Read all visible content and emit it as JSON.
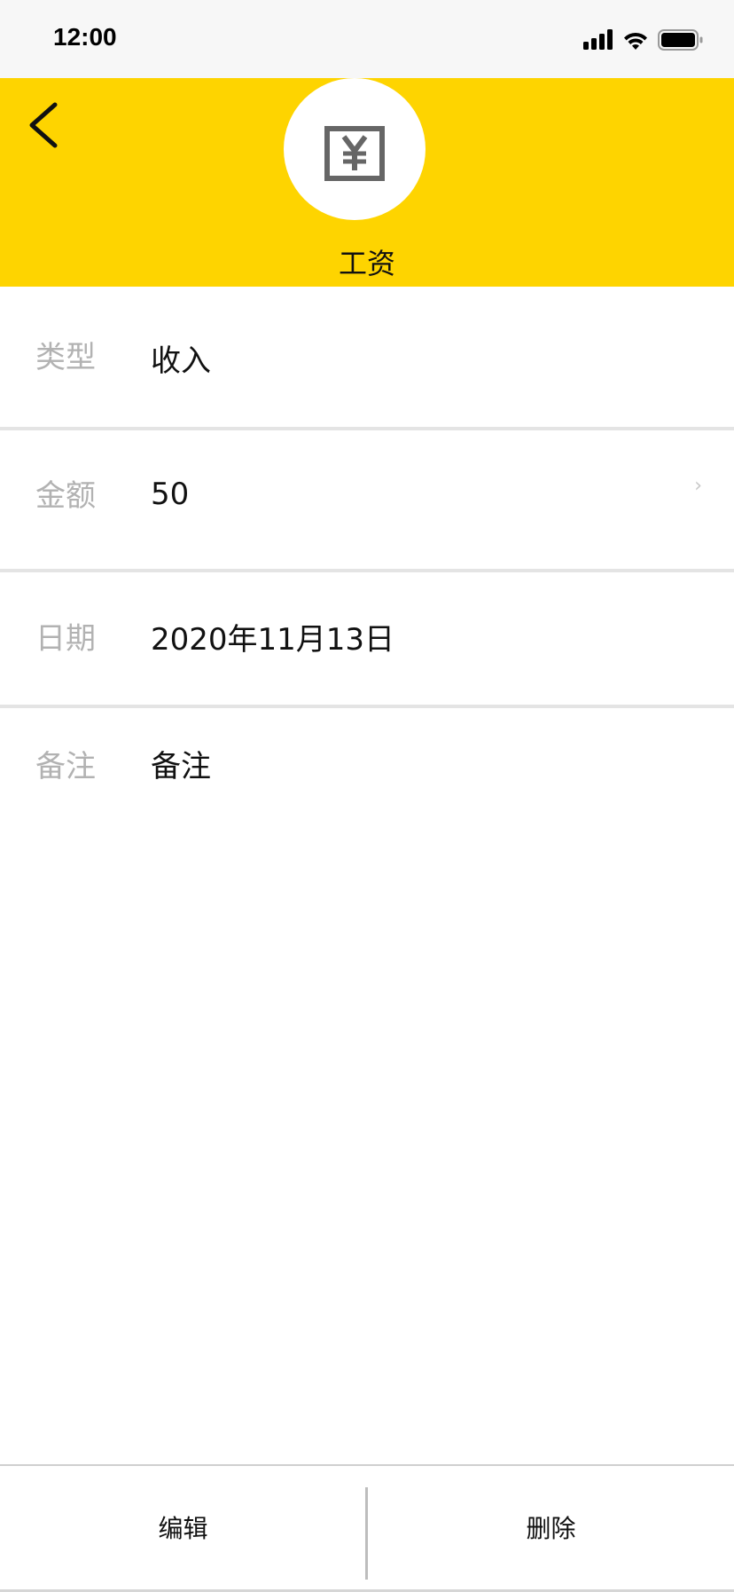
{
  "status_bar": {
    "time": "12:00"
  },
  "header": {
    "category_name": "工资",
    "category_icon": "yuan-receipt-icon",
    "background_color": "#fed400"
  },
  "details": [
    {
      "label": "类型",
      "value": "收入"
    },
    {
      "label": "金额",
      "value": "50",
      "chevron": "›"
    },
    {
      "label": "日期",
      "value": "2020年11月13日"
    },
    {
      "label": "备注",
      "value": "备注"
    }
  ],
  "footer": {
    "edit_label": "编辑",
    "delete_label": "删除"
  }
}
